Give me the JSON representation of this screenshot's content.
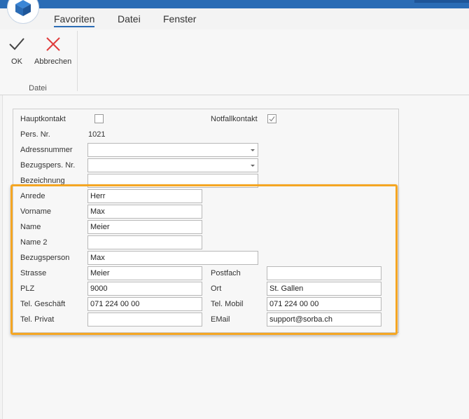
{
  "menu": {
    "tabs": [
      "Favoriten",
      "Datei",
      "Fenster"
    ]
  },
  "ribbon": {
    "ok_label": "OK",
    "cancel_label": "Abbrechen",
    "group_label": "Datei"
  },
  "form": {
    "hauptkontakt_label": "Hauptkontakt",
    "notfallkontakt_label": "Notfallkontakt",
    "hauptkontakt_checked": false,
    "notfallkontakt_checked": true,
    "persnr_label": "Pers. Nr.",
    "persnr_value": "1021",
    "adressnummer_label": "Adressnummer",
    "adressnummer_value": "",
    "bezugspersnr_label": "Bezugspers. Nr.",
    "bezugspersnr_value": "",
    "bezeichnung_label": "Bezeichnung",
    "bezeichnung_value": "",
    "anrede_label": "Anrede",
    "anrede_value": "Herr",
    "vorname_label": "Vorname",
    "vorname_value": "Max",
    "name_label": "Name",
    "name_value": "Meier",
    "name2_label": "Name 2",
    "name2_value": "",
    "bezugsperson_label": "Bezugsperson",
    "bezugsperson_value": "Max",
    "strasse_label": "Strasse",
    "strasse_value": "Meier",
    "postfach_label": "Postfach",
    "postfach_value": "",
    "plz_label": "PLZ",
    "plz_value": "9000",
    "ort_label": "Ort",
    "ort_value": "St. Gallen",
    "telgeschaeft_label": "Tel. Geschäft",
    "telgeschaeft_value": "071 224 00 00",
    "telmobil_label": "Tel. Mobil",
    "telmobil_value": "071 224 00 00",
    "telprivat_label": "Tel. Privat",
    "telprivat_value": "",
    "email_label": "EMail",
    "email_value": "support@sorba.ch"
  },
  "colors": {
    "accent": "#2b6cb5",
    "highlight": "#f5a623",
    "cancel": "#e03c3c"
  }
}
